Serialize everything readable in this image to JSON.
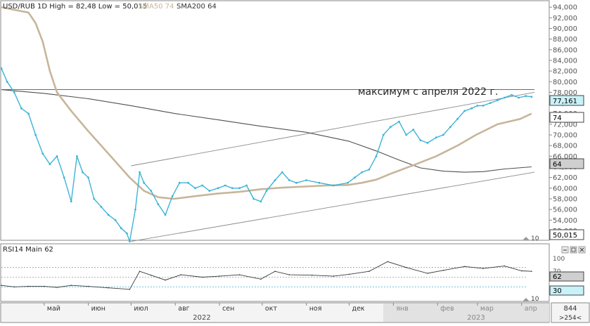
{
  "header": {
    "symbol_info": "USD/RUB 1D High = 82,48 Low = 50,015",
    "sma50_label": "SMA50 74",
    "sma200_label": "SMA200 64"
  },
  "annotation": "максимум с апреля 2022 г.",
  "price_badges": {
    "last": "77,161",
    "sma50": "74",
    "sma200": "64",
    "low": "50,015"
  },
  "volume_marker": "10",
  "rsi_panel": {
    "label": "RSI14 Main 62",
    "ticks": [
      "100",
      "70",
      "30"
    ],
    "badges": {
      "value": "62",
      "level": "30"
    },
    "marker": "10",
    "levels": [
      70,
      50,
      30
    ]
  },
  "x_axis": {
    "months": [
      "май",
      "июн",
      "июл",
      "авг",
      "сен",
      "окт",
      "ноя",
      "дек",
      "янв",
      "фев",
      "мар",
      "апр"
    ],
    "years": [
      "2022",
      "2023"
    ]
  },
  "corner": {
    "count": "844",
    "nav": ">254<"
  },
  "colors": {
    "price": "#3cb4d6",
    "sma50": "#c8b59a",
    "sma200": "#505050",
    "channel": "#8a8a8a",
    "rsi": "#3a3a3a"
  },
  "chart_data": {
    "type": "line",
    "title": "USD/RUB 1D",
    "x_range": [
      "2022-04-01",
      "2023-04-10"
    ],
    "y_range": [
      50,
      95
    ],
    "y_ticks": [
      52,
      54,
      56,
      58,
      60,
      62,
      64,
      66,
      68,
      70,
      72,
      74,
      76,
      78,
      80,
      82,
      84,
      86,
      88,
      90,
      92,
      94
    ],
    "series": [
      {
        "name": "USD/RUB",
        "points": [
          [
            "2022-04-01",
            82.5
          ],
          [
            "2022-04-05",
            80.0
          ],
          [
            "2022-04-10",
            78.0
          ],
          [
            "2022-04-15",
            75.0
          ],
          [
            "2022-04-20",
            74.0
          ],
          [
            "2022-04-25",
            70.0
          ],
          [
            "2022-04-30",
            66.5
          ],
          [
            "2022-05-05",
            64.5
          ],
          [
            "2022-05-10",
            66.0
          ],
          [
            "2022-05-15",
            62.0
          ],
          [
            "2022-05-20",
            57.5
          ],
          [
            "2022-05-24",
            66.0
          ],
          [
            "2022-05-28",
            63.0
          ],
          [
            "2022-06-01",
            62.0
          ],
          [
            "2022-06-05",
            58.0
          ],
          [
            "2022-06-10",
            56.5
          ],
          [
            "2022-06-15",
            55.0
          ],
          [
            "2022-06-20",
            54.0
          ],
          [
            "2022-06-24",
            52.5
          ],
          [
            "2022-06-28",
            51.5
          ],
          [
            "2022-06-30",
            50.0
          ],
          [
            "2022-07-04",
            56.0
          ],
          [
            "2022-07-07",
            63.0
          ],
          [
            "2022-07-10",
            61.0
          ],
          [
            "2022-07-15",
            59.5
          ],
          [
            "2022-07-20",
            57.0
          ],
          [
            "2022-07-25",
            55.0
          ],
          [
            "2022-07-30",
            58.5
          ],
          [
            "2022-08-04",
            61.0
          ],
          [
            "2022-08-10",
            61.0
          ],
          [
            "2022-08-15",
            60.0
          ],
          [
            "2022-08-20",
            60.5
          ],
          [
            "2022-08-25",
            59.5
          ],
          [
            "2022-08-31",
            60.0
          ],
          [
            "2022-09-05",
            60.5
          ],
          [
            "2022-09-10",
            60.0
          ],
          [
            "2022-09-15",
            60.0
          ],
          [
            "2022-09-20",
            60.5
          ],
          [
            "2022-09-25",
            58.0
          ],
          [
            "2022-09-30",
            57.5
          ],
          [
            "2022-10-04",
            59.5
          ],
          [
            "2022-10-10",
            61.5
          ],
          [
            "2022-10-15",
            63.0
          ],
          [
            "2022-10-20",
            61.5
          ],
          [
            "2022-10-25",
            61.0
          ],
          [
            "2022-11-01",
            61.5
          ],
          [
            "2022-11-10",
            61.0
          ],
          [
            "2022-11-20",
            60.5
          ],
          [
            "2022-11-30",
            61.0
          ],
          [
            "2022-12-05",
            62.0
          ],
          [
            "2022-12-10",
            63.0
          ],
          [
            "2022-12-15",
            63.5
          ],
          [
            "2022-12-20",
            66.0
          ],
          [
            "2022-12-25",
            70.0
          ],
          [
            "2022-12-30",
            71.5
          ],
          [
            "2023-01-05",
            72.5
          ],
          [
            "2023-01-10",
            70.0
          ],
          [
            "2023-01-15",
            71.0
          ],
          [
            "2023-01-20",
            69.0
          ],
          [
            "2023-01-25",
            68.5
          ],
          [
            "2023-01-31",
            69.5
          ],
          [
            "2023-02-05",
            70.0
          ],
          [
            "2023-02-10",
            71.5
          ],
          [
            "2023-02-15",
            73.0
          ],
          [
            "2023-02-20",
            74.5
          ],
          [
            "2023-02-25",
            75.0
          ],
          [
            "2023-03-01",
            75.5
          ],
          [
            "2023-03-05",
            75.5
          ],
          [
            "2023-03-10",
            76.0
          ],
          [
            "2023-03-15",
            76.5
          ],
          [
            "2023-03-20",
            77.0
          ],
          [
            "2023-03-25",
            77.5
          ],
          [
            "2023-03-30",
            77.0
          ],
          [
            "2023-04-04",
            77.3
          ],
          [
            "2023-04-08",
            77.161
          ]
        ]
      },
      {
        "name": "SMA50",
        "points": [
          [
            "2022-04-01",
            94.0
          ],
          [
            "2022-04-10",
            93.5
          ],
          [
            "2022-04-20",
            93.0
          ],
          [
            "2022-04-25",
            91.0
          ],
          [
            "2022-04-30",
            87.5
          ],
          [
            "2022-05-05",
            82.0
          ],
          [
            "2022-05-10",
            78.0
          ],
          [
            "2022-05-20",
            74.5
          ],
          [
            "2022-05-31",
            71.0
          ],
          [
            "2022-06-10",
            68.0
          ],
          [
            "2022-06-20",
            65.0
          ],
          [
            "2022-06-30",
            62.0
          ],
          [
            "2022-07-10",
            59.5
          ],
          [
            "2022-07-20",
            58.3
          ],
          [
            "2022-07-31",
            58.0
          ],
          [
            "2022-08-15",
            58.5
          ],
          [
            "2022-08-31",
            59.0
          ],
          [
            "2022-09-15",
            59.3
          ],
          [
            "2022-09-30",
            59.8
          ],
          [
            "2022-10-15",
            60.1
          ],
          [
            "2022-10-31",
            60.3
          ],
          [
            "2022-11-15",
            60.5
          ],
          [
            "2022-11-30",
            60.6
          ],
          [
            "2022-12-10",
            61.0
          ],
          [
            "2022-12-20",
            61.6
          ],
          [
            "2022-12-31",
            62.8
          ],
          [
            "2023-01-15",
            64.3
          ],
          [
            "2023-01-31",
            66.0
          ],
          [
            "2023-02-15",
            68.0
          ],
          [
            "2023-02-28",
            70.0
          ],
          [
            "2023-03-15",
            72.0
          ],
          [
            "2023-03-31",
            73.0
          ],
          [
            "2023-04-08",
            74.0
          ]
        ]
      },
      {
        "name": "SMA200",
        "points": [
          [
            "2022-04-01",
            78.5
          ],
          [
            "2022-05-01",
            77.8
          ],
          [
            "2022-06-01",
            76.8
          ],
          [
            "2022-07-01",
            75.5
          ],
          [
            "2022-08-01",
            74.0
          ],
          [
            "2022-09-01",
            72.8
          ],
          [
            "2022-10-01",
            71.6
          ],
          [
            "2022-11-01",
            70.5
          ],
          [
            "2022-12-01",
            68.8
          ],
          [
            "2022-12-20",
            67.0
          ],
          [
            "2023-01-05",
            65.3
          ],
          [
            "2023-01-20",
            63.8
          ],
          [
            "2023-02-05",
            63.2
          ],
          [
            "2023-02-20",
            63.0
          ],
          [
            "2023-03-05",
            63.1
          ],
          [
            "2023-03-20",
            63.6
          ],
          [
            "2023-04-08",
            64.0
          ]
        ]
      },
      {
        "name": "resistance",
        "points": [
          [
            "2022-04-01",
            78.5
          ],
          [
            "2023-04-10",
            78.5
          ]
        ]
      },
      {
        "name": "channel-upper",
        "points": [
          [
            "2022-07-01",
            64.2
          ],
          [
            "2023-04-10",
            78.0
          ]
        ]
      },
      {
        "name": "channel-lower",
        "points": [
          [
            "2022-07-01",
            50.0
          ],
          [
            "2023-04-10",
            63.0
          ]
        ]
      }
    ],
    "rsi": {
      "name": "RSI14",
      "y_range": [
        0,
        100
      ],
      "points": [
        [
          "2022-04-01",
          33
        ],
        [
          "2022-04-10",
          30
        ],
        [
          "2022-04-20",
          31
        ],
        [
          "2022-05-01",
          31
        ],
        [
          "2022-05-10",
          29
        ],
        [
          "2022-05-20",
          33
        ],
        [
          "2022-06-01",
          31
        ],
        [
          "2022-06-15",
          28
        ],
        [
          "2022-06-30",
          25
        ],
        [
          "2022-07-07",
          62
        ],
        [
          "2022-07-15",
          54
        ],
        [
          "2022-07-25",
          44
        ],
        [
          "2022-08-05",
          55
        ],
        [
          "2022-08-20",
          50
        ],
        [
          "2022-09-01",
          52
        ],
        [
          "2022-09-15",
          55
        ],
        [
          "2022-09-30",
          46
        ],
        [
          "2022-10-10",
          62
        ],
        [
          "2022-10-20",
          55
        ],
        [
          "2022-11-05",
          54
        ],
        [
          "2022-11-20",
          52
        ],
        [
          "2022-12-01",
          56
        ],
        [
          "2022-12-15",
          62
        ],
        [
          "2022-12-28",
          82
        ],
        [
          "2023-01-10",
          70
        ],
        [
          "2023-01-25",
          58
        ],
        [
          "2023-02-05",
          64
        ],
        [
          "2023-02-20",
          72
        ],
        [
          "2023-03-05",
          68
        ],
        [
          "2023-03-20",
          73
        ],
        [
          "2023-04-01",
          63
        ],
        [
          "2023-04-08",
          62
        ]
      ]
    }
  }
}
